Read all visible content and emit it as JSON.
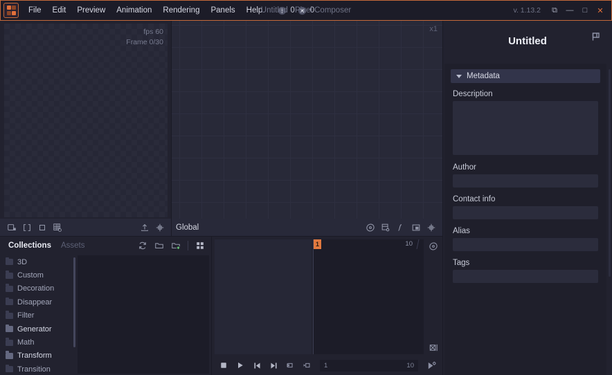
{
  "titlebar": {
    "logo_name": "pixel-composer-logo",
    "menus": [
      "File",
      "Edit",
      "Preview",
      "Animation",
      "Rendering",
      "Panels",
      "Help"
    ],
    "notice_count": "0",
    "error_count": "0",
    "window_title": "Untitled - Pixel Composer",
    "version": "v. 1.13.2",
    "buttons": {
      "restore_layout": "⧉",
      "minimize": "—",
      "maximize": "□",
      "close": "✕"
    },
    "accent_color": "#c4693a"
  },
  "preview": {
    "fps_label": "fps 60",
    "frame_label": "Frame 0/30",
    "tools": [
      {
        "name": "lock-canvas-icon",
        "label": "Lock canvas"
      },
      {
        "name": "brackets-icon",
        "label": "Fit content"
      },
      {
        "name": "square-icon",
        "label": "Actual size"
      },
      {
        "name": "grid-settings-icon",
        "label": "Grid settings"
      }
    ],
    "right_tools": [
      {
        "name": "export-icon",
        "label": "Export image"
      },
      {
        "name": "recenter-icon",
        "label": "Recenter view"
      }
    ]
  },
  "graph": {
    "zoom_level": "x1",
    "context_label": "Global",
    "tools": [
      {
        "name": "node-preview-icon",
        "label": "Preview node"
      },
      {
        "name": "node-list-icon",
        "label": "Node list"
      },
      {
        "name": "curve-icon",
        "label": "Connection curve"
      },
      {
        "name": "minimap-icon",
        "label": "Minimap"
      },
      {
        "name": "recenter-graph-icon",
        "label": "Recenter graph"
      }
    ]
  },
  "collections": {
    "tabs": [
      {
        "label": "Collections",
        "active": true
      },
      {
        "label": "Assets",
        "active": false
      }
    ],
    "tools": [
      {
        "name": "refresh-icon",
        "label": "Refresh"
      },
      {
        "name": "folder-icon",
        "label": "Open folder"
      },
      {
        "name": "add-folder-icon",
        "label": "New folder"
      },
      {
        "name": "grid-view-icon",
        "label": "Grid view"
      }
    ],
    "folders": [
      {
        "label": "3D",
        "highlighted": false
      },
      {
        "label": "Custom",
        "highlighted": false
      },
      {
        "label": "Decoration",
        "highlighted": false
      },
      {
        "label": "Disappear",
        "highlighted": false
      },
      {
        "label": "Filter",
        "highlighted": false
      },
      {
        "label": "Generator",
        "highlighted": true
      },
      {
        "label": "Math",
        "highlighted": false
      },
      {
        "label": "Transform",
        "highlighted": true
      },
      {
        "label": "Transition",
        "highlighted": false
      }
    ]
  },
  "timeline": {
    "playhead_frame": "1",
    "range_end": "10",
    "range_start_value": "1",
    "range_end_value": "10",
    "transport": [
      {
        "name": "stop-button",
        "glyph": "■",
        "label": "Stop"
      },
      {
        "name": "play-button",
        "glyph": "▶",
        "label": "Play"
      },
      {
        "name": "first-frame-button",
        "glyph": "⏮",
        "label": "Jump to start"
      },
      {
        "name": "last-frame-button",
        "glyph": "⏭",
        "label": "Jump to end"
      },
      {
        "name": "prev-keyframe-button",
        "glyph": "◁",
        "label": "Previous keyframe"
      },
      {
        "name": "next-keyframe-button",
        "glyph": "▷",
        "label": "Next keyframe"
      }
    ],
    "side_tools": [
      {
        "name": "keyframe-tool-icon",
        "label": "Keyframe tool"
      },
      {
        "name": "scale-keys-icon",
        "label": "Scale keyframes"
      }
    ],
    "settings_tool": {
      "name": "animation-settings-icon",
      "label": "Animation settings"
    }
  },
  "inspector": {
    "title": "Untitled",
    "save_icon": "save-icon",
    "section": {
      "title": "Metadata",
      "expanded": true
    },
    "fields": [
      {
        "label": "Description",
        "value": "",
        "type": "textarea"
      },
      {
        "label": "Author",
        "value": "",
        "type": "text"
      },
      {
        "label": "Contact info",
        "value": "",
        "type": "text"
      },
      {
        "label": "Alias",
        "value": "",
        "type": "text"
      },
      {
        "label": "Tags",
        "value": "",
        "type": "text"
      }
    ]
  }
}
